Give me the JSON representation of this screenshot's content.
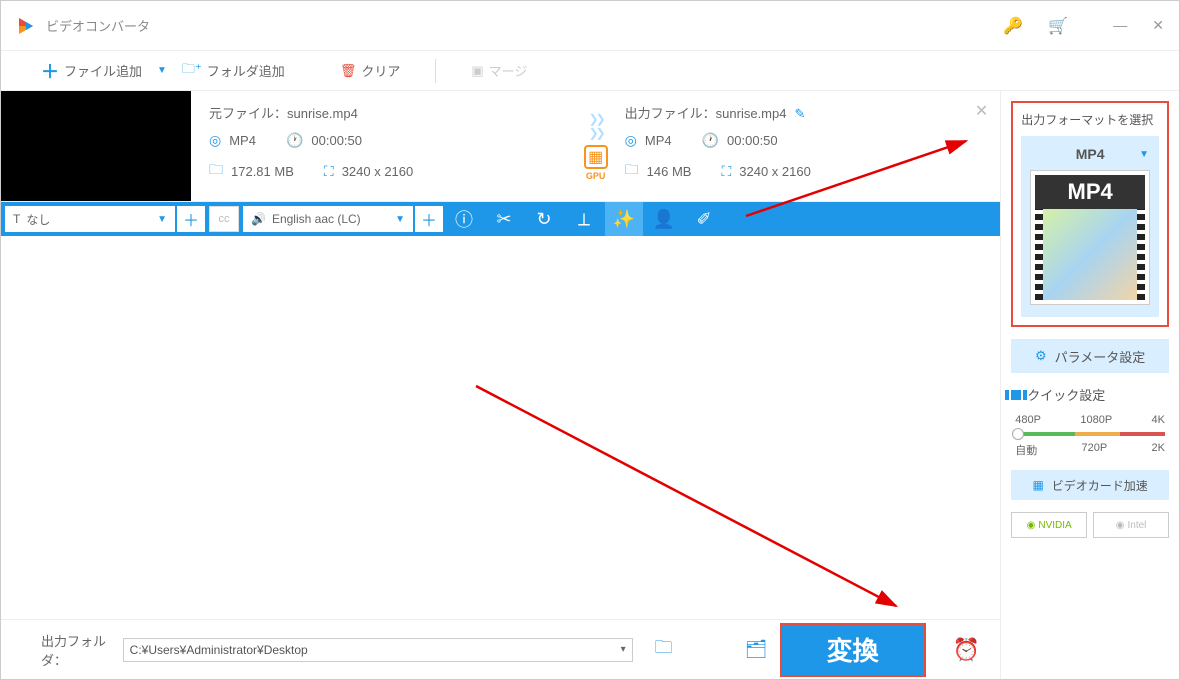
{
  "app": {
    "title": "ビデオコンバータ"
  },
  "toolbar": {
    "add_file": "ファイル追加",
    "add_folder": "フォルダ追加",
    "clear": "クリア",
    "merge": "マージ"
  },
  "file": {
    "source_label": "元ファイル：",
    "source_name": "sunrise.mp4",
    "output_label": "出力ファイル：",
    "output_name": "sunrise.mp4",
    "source_format": "MP4",
    "source_duration": "00:00:50",
    "source_size": "172.81 MB",
    "source_resolution": "3240 x 2160",
    "output_format": "MP4",
    "output_duration": "00:00:50",
    "output_size": "146 MB",
    "output_resolution": "3240 x 2160",
    "gpu_label": "GPU"
  },
  "actionbar": {
    "subtitle_none": "なし",
    "audio_track": "English aac (LC)"
  },
  "sidebar": {
    "format_section_title": "出力フォーマットを選択",
    "format_selected": "MP4",
    "format_badge": "MP4",
    "param_btn": "パラメータ設定",
    "quick_title": "クイック設定",
    "presets_top": [
      "480P",
      "1080P",
      "4K"
    ],
    "presets_bottom": [
      "自動",
      "720P",
      "2K"
    ],
    "gpu_accel": "ビデオカード加速",
    "nvidia": "NVIDIA",
    "intel": "Intel"
  },
  "bottom": {
    "output_folder_label": "出力フォルダ：",
    "output_folder_path": "C:¥Users¥Administrator¥Desktop",
    "convert": "変換"
  }
}
